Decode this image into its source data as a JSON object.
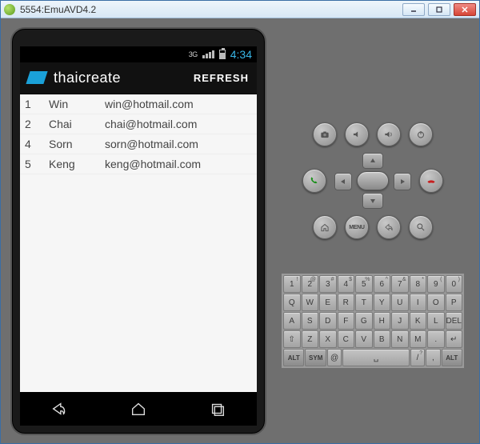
{
  "window": {
    "title": "5554:EmuAVD4.2",
    "min_label": "Minimize",
    "max_label": "Maximize",
    "close_label": "Close"
  },
  "statusbar": {
    "network": "3G",
    "clock": "4:34"
  },
  "actionbar": {
    "app_title": "thaicreate",
    "refresh_label": "REFRESH"
  },
  "table": {
    "rows": [
      {
        "id": "1",
        "name": "Win",
        "email": "win@hotmail.com"
      },
      {
        "id": "2",
        "name": "Chai",
        "email": "chai@hotmail.com"
      },
      {
        "id": "4",
        "name": "Sorn",
        "email": "sorn@hotmail.com"
      },
      {
        "id": "5",
        "name": "Keng",
        "email": "keng@hotmail.com"
      }
    ]
  },
  "navbar": {
    "back": "Back",
    "home": "Home",
    "recent": "Recent apps"
  },
  "controls": {
    "row1": [
      "camera-icon",
      "volume-down-icon",
      "volume-up-icon",
      "power-icon"
    ],
    "call": "Call",
    "end": "End call",
    "row3": [
      "home-icon",
      "menu-icon",
      "back-icon",
      "search-icon"
    ],
    "menu_text": "MENU"
  },
  "keyboard": {
    "rows": [
      [
        {
          "main": "1",
          "sub": "!"
        },
        {
          "main": "2",
          "sub": "@"
        },
        {
          "main": "3",
          "sub": "#"
        },
        {
          "main": "4",
          "sub": "$"
        },
        {
          "main": "5",
          "sub": "%"
        },
        {
          "main": "6",
          "sub": "^"
        },
        {
          "main": "7",
          "sub": "&"
        },
        {
          "main": "8",
          "sub": "*"
        },
        {
          "main": "9",
          "sub": "("
        },
        {
          "main": "0",
          "sub": ")"
        }
      ],
      [
        {
          "main": "Q"
        },
        {
          "main": "W"
        },
        {
          "main": "E"
        },
        {
          "main": "R"
        },
        {
          "main": "T"
        },
        {
          "main": "Y"
        },
        {
          "main": "U"
        },
        {
          "main": "I"
        },
        {
          "main": "O"
        },
        {
          "main": "P"
        }
      ],
      [
        {
          "main": "A"
        },
        {
          "main": "S"
        },
        {
          "main": "D"
        },
        {
          "main": "F"
        },
        {
          "main": "G"
        },
        {
          "main": "H"
        },
        {
          "main": "J"
        },
        {
          "main": "K"
        },
        {
          "main": "L"
        },
        {
          "main": "DEL",
          "sub": ""
        }
      ],
      [
        {
          "main": "⇧",
          "w": "w1"
        },
        {
          "main": "Z"
        },
        {
          "main": "X"
        },
        {
          "main": "C"
        },
        {
          "main": "V"
        },
        {
          "main": "B"
        },
        {
          "main": "N"
        },
        {
          "main": "M"
        },
        {
          "main": "."
        },
        {
          "main": "↵",
          "w": "w1"
        }
      ],
      [
        {
          "main": "ALT",
          "w": "w15",
          "cls": "alt"
        },
        {
          "main": "SYM",
          "w": "w15",
          "cls": "alt"
        },
        {
          "main": "@",
          "w": "w1"
        },
        {
          "main": "␣",
          "w": "w5"
        },
        {
          "main": "/",
          "sub": "?",
          "w": "w1"
        },
        {
          "main": ",",
          "sub": "",
          "w": "w1"
        },
        {
          "main": "ALT",
          "w": "w15",
          "cls": "alt"
        }
      ]
    ]
  }
}
